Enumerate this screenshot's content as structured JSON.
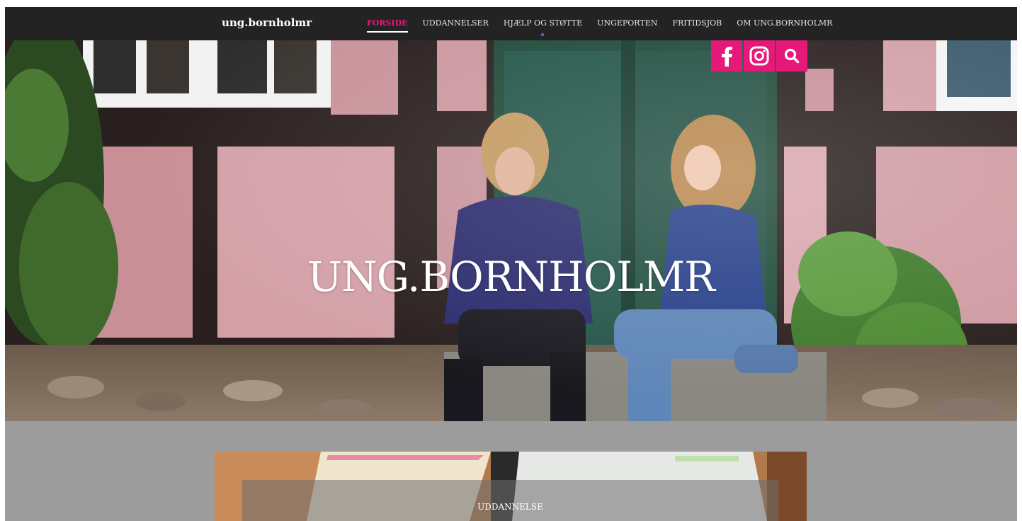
{
  "brand": "ung.bornholmr",
  "nav": {
    "items": [
      {
        "label": "FORSIDE",
        "active": true
      },
      {
        "label": "UDDANNELSER",
        "active": false
      },
      {
        "label": "HJÆLP OG STØTTE",
        "active": false
      },
      {
        "label": "UNGEPORTEN",
        "active": false
      },
      {
        "label": "FRITIDSJOB",
        "active": false
      },
      {
        "label": "OM UNG.BORNHOLMR",
        "active": false
      }
    ]
  },
  "hero": {
    "title": "UNG.BORNHOLMR"
  },
  "social": {
    "facebook_icon": "facebook-icon",
    "instagram_icon": "instagram-icon",
    "search_icon": "search-icon"
  },
  "card": {
    "label": "UDDANNELSE"
  },
  "colors": {
    "accent": "#e6197a",
    "nav_bg": "#232323",
    "page_bg": "#9c9c9c"
  }
}
